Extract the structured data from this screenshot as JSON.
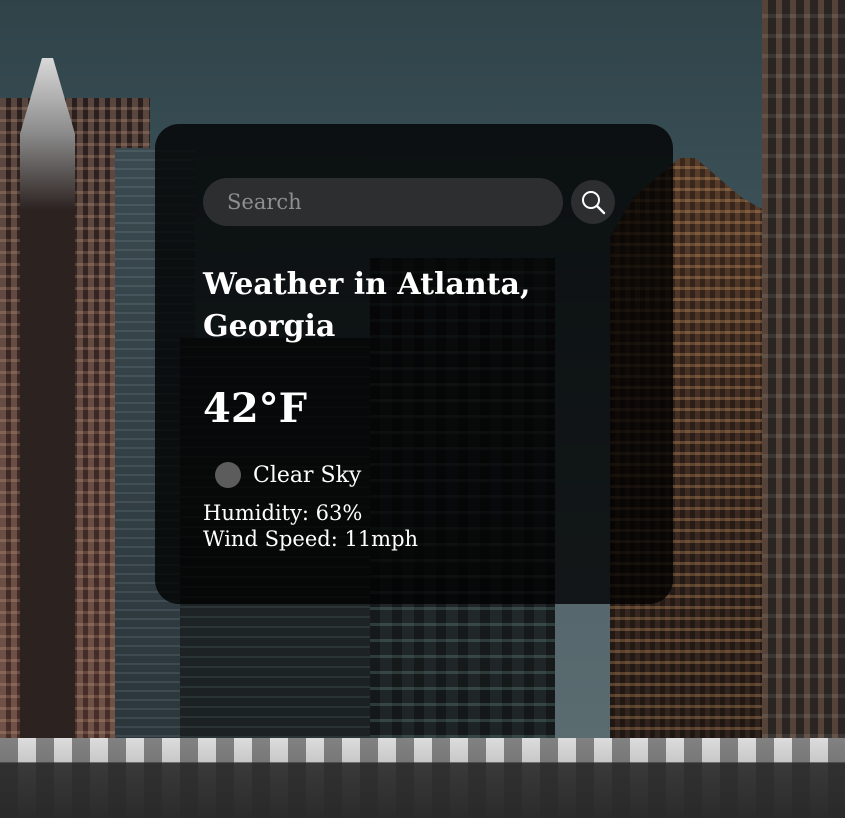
{
  "search": {
    "placeholder": "Search",
    "value": ""
  },
  "weather": {
    "title": "Weather in Atlanta, Georgia",
    "temperature": "42°F",
    "description": "Clear Sky",
    "icon": "weather-condition-icon",
    "humidity_text": "Humidity: 63%",
    "wind_text": "Wind Speed: 11mph"
  },
  "icons": {
    "search": "search-icon"
  },
  "colors": {
    "card_background": "#000000c7",
    "input_background": "#2c2e2f",
    "text": "#ffffff",
    "placeholder": "#8f8f8f"
  }
}
